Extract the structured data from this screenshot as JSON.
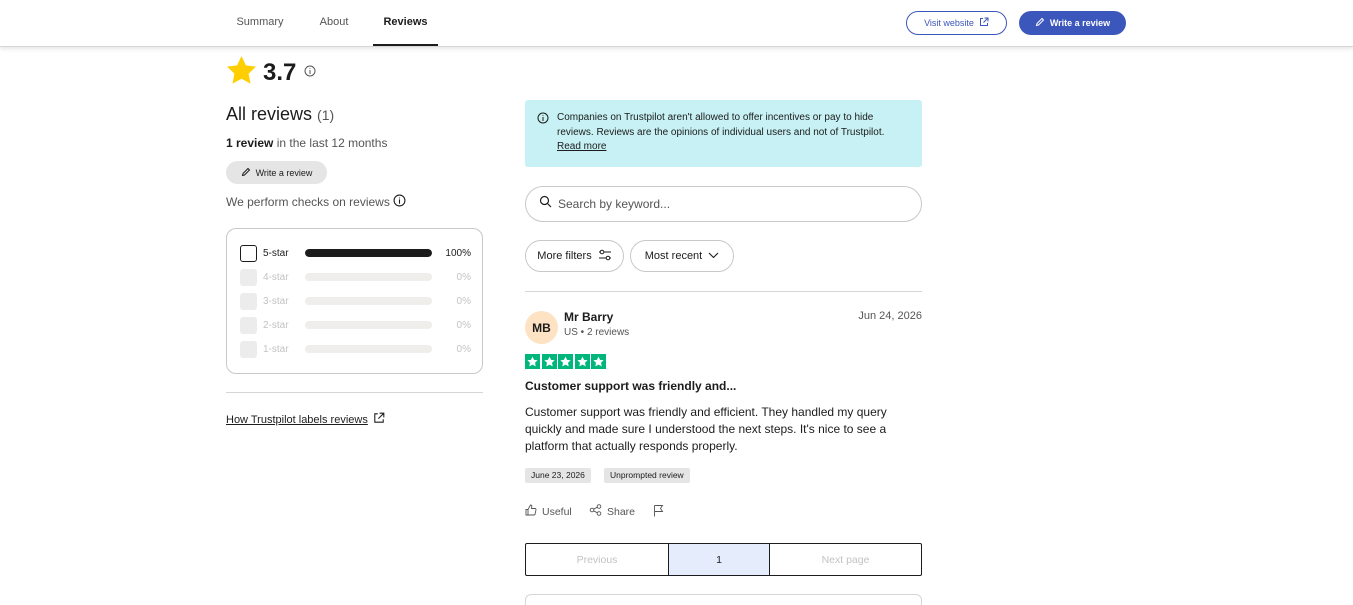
{
  "nav": {
    "tabs": [
      {
        "label": "Summary"
      },
      {
        "label": "About"
      },
      {
        "label": "Reviews",
        "active": true
      }
    ],
    "visit_label": "Visit website",
    "write_label": "Write a review"
  },
  "summary": {
    "rating": "3.7",
    "all_reviews_label": "All reviews",
    "all_reviews_count": "(1)",
    "last_count": "1 review",
    "last_suffix": " in the last 12 months",
    "write_label": "Write a review",
    "checks_label": "We perform checks on reviews",
    "distribution": [
      {
        "label": "5-star",
        "pct": "100%",
        "fraction": 1.0,
        "enabled": true
      },
      {
        "label": "4-star",
        "pct": "0%",
        "fraction": 0,
        "enabled": false
      },
      {
        "label": "3-star",
        "pct": "0%",
        "fraction": 0,
        "enabled": false
      },
      {
        "label": "2-star",
        "pct": "0%",
        "fraction": 0,
        "enabled": false
      },
      {
        "label": "1-star",
        "pct": "0%",
        "fraction": 0,
        "enabled": false
      }
    ],
    "labels_link": "How Trustpilot labels reviews"
  },
  "notice": {
    "text": "Companies on Trustpilot aren't allowed to offer incentives or pay to hide reviews. Reviews are the opinions of individual users and not of Trustpilot.",
    "link": "Read more"
  },
  "search": {
    "placeholder": "Search by keyword..."
  },
  "filters": {
    "more_label": "More filters",
    "sort_label": "Most recent"
  },
  "review": {
    "initials": "MB",
    "name": "Mr Barry",
    "meta": "US • 2 reviews",
    "date": "Jun 24, 2026",
    "stars": 5,
    "title": "Customer support was friendly and...",
    "body": "Customer support was friendly and efficient. They handled my query quickly and made sure I understood the next steps. It's nice to see a platform that actually responds properly.",
    "experience_date": "June 23, 2026",
    "tag": "Unprompted review",
    "useful_label": "Useful",
    "share_label": "Share"
  },
  "pagination": {
    "previous": "Previous",
    "current": "1",
    "next": "Next page"
  },
  "colors": {
    "brand": "#3c57bc",
    "star_green": "#00b67a",
    "rating_star": "#ffce00",
    "notice_bg": "#c7f1f4"
  }
}
